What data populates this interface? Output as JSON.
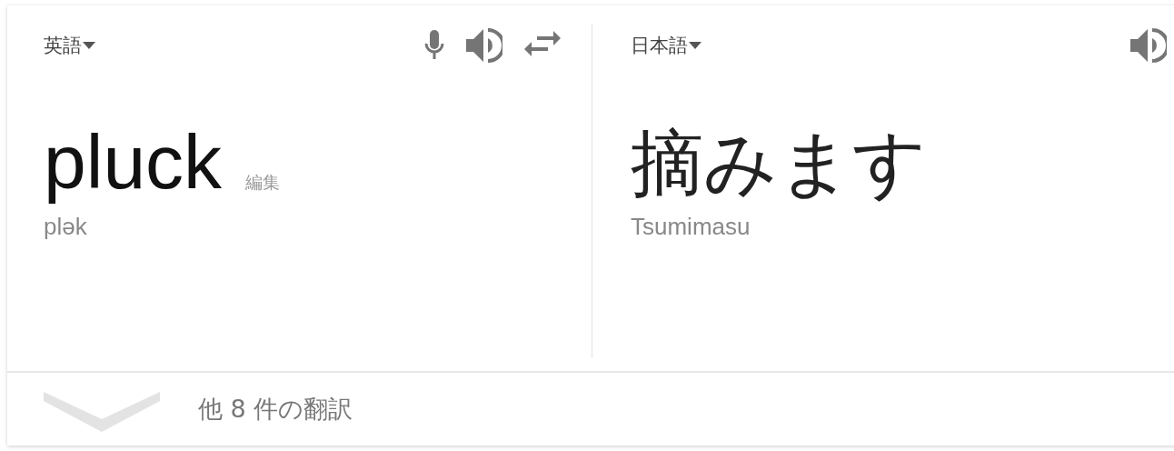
{
  "source": {
    "language": "英語",
    "text": "pluck",
    "edit_link": "編集",
    "phonetic": "plək"
  },
  "target": {
    "language": "日本語",
    "text": "摘みます",
    "romanization": "Tsumimasu"
  },
  "footer": {
    "label": "他 8 件の翻訳",
    "expanded": false
  }
}
